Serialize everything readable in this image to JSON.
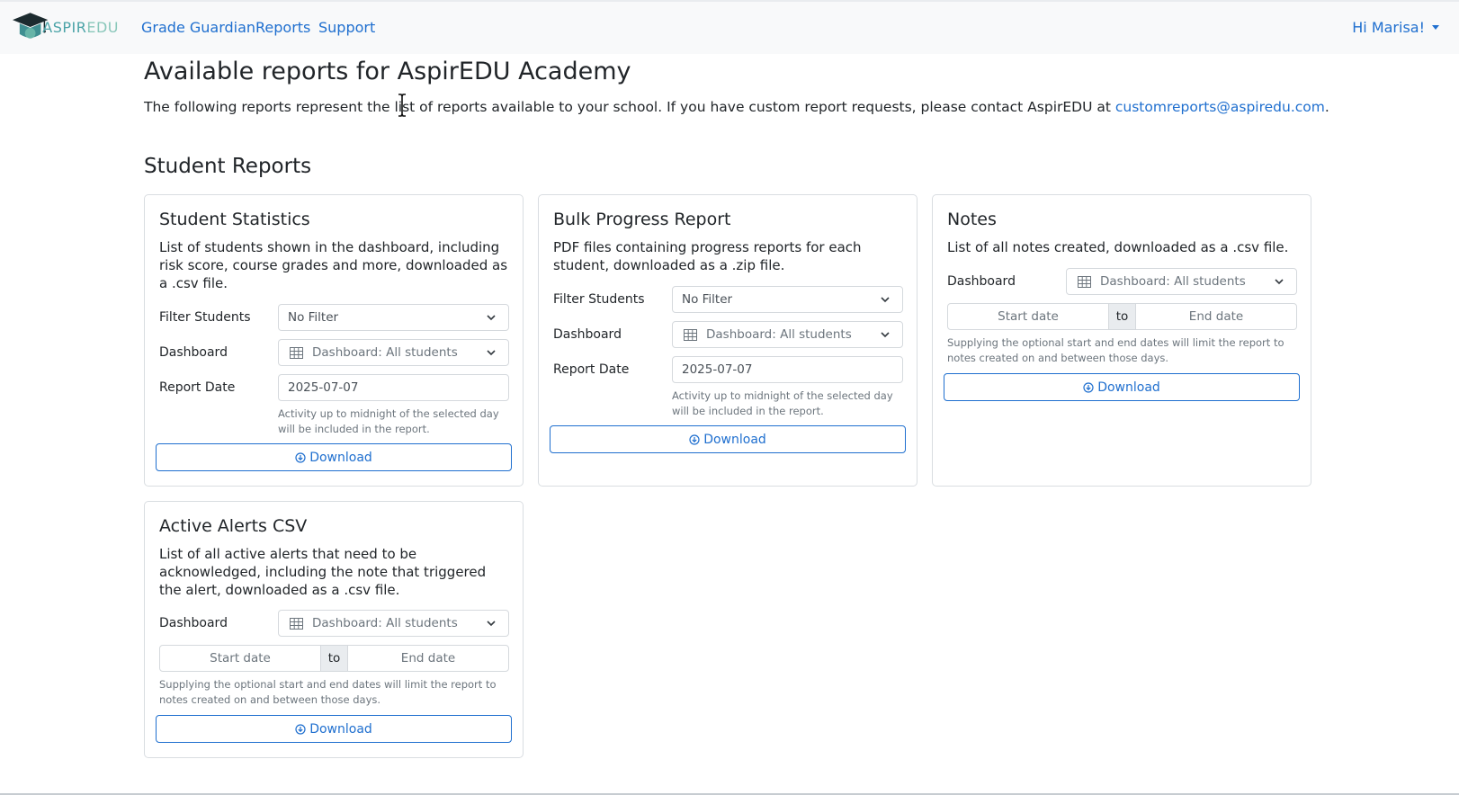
{
  "nav": {
    "brand_main": "ASPIR",
    "brand_edu": "EDU",
    "links": [
      "Grade Guardian",
      "Reports",
      "Support"
    ],
    "user": "Hi Marisa!"
  },
  "page": {
    "title": "Available reports for AspirEDU Academy",
    "intro_text": "The following reports represent the list of reports available to your school. If you have custom report requests, please contact AspirEDU at ",
    "email": "customreports@aspiredu.com",
    "intro_end": "."
  },
  "section": {
    "title": "Student Reports"
  },
  "labels": {
    "filter_students": "Filter Students",
    "dashboard": "Dashboard",
    "report_date": "Report Date",
    "download": "Download",
    "start_date": "Start date",
    "to": "to",
    "end_date": "End date"
  },
  "cards": [
    {
      "title": "Student Statistics",
      "description": "List of students shown in the dashboard, including risk score, course grades and more, downloaded as a .csv file.",
      "filter_value": "No Filter",
      "dashboard_value": "Dashboard: All students",
      "report_date": "2025-07-07",
      "help": "Activity up to midnight of the selected day will be included in the report."
    },
    {
      "title": "Bulk Progress Report",
      "description": "PDF files containing progress reports for each student, downloaded as a .zip file.",
      "filter_value": "No Filter",
      "dashboard_value": "Dashboard: All students",
      "report_date": "2025-07-07",
      "help": "Activity up to midnight of the selected day will be included in the report."
    },
    {
      "title": "Notes",
      "description": "List of all notes created, downloaded as a .csv file.",
      "dashboard_value": "Dashboard: All students",
      "help": "Supplying the optional start and end dates will limit the report to notes created on and between those days."
    },
    {
      "title": "Active Alerts CSV",
      "description": "List of all active alerts that need to be acknowledged, including the note that triggered the alert, downloaded as a .csv file.",
      "dashboard_value": "Dashboard: All students",
      "help": "Supplying the optional start and end dates will limit the report to notes created on and between those days."
    }
  ],
  "colors": {
    "link": "#1f6fcf",
    "border": "#d9dde1",
    "muted": "#6c757d",
    "brand": "#4aa3a7"
  }
}
